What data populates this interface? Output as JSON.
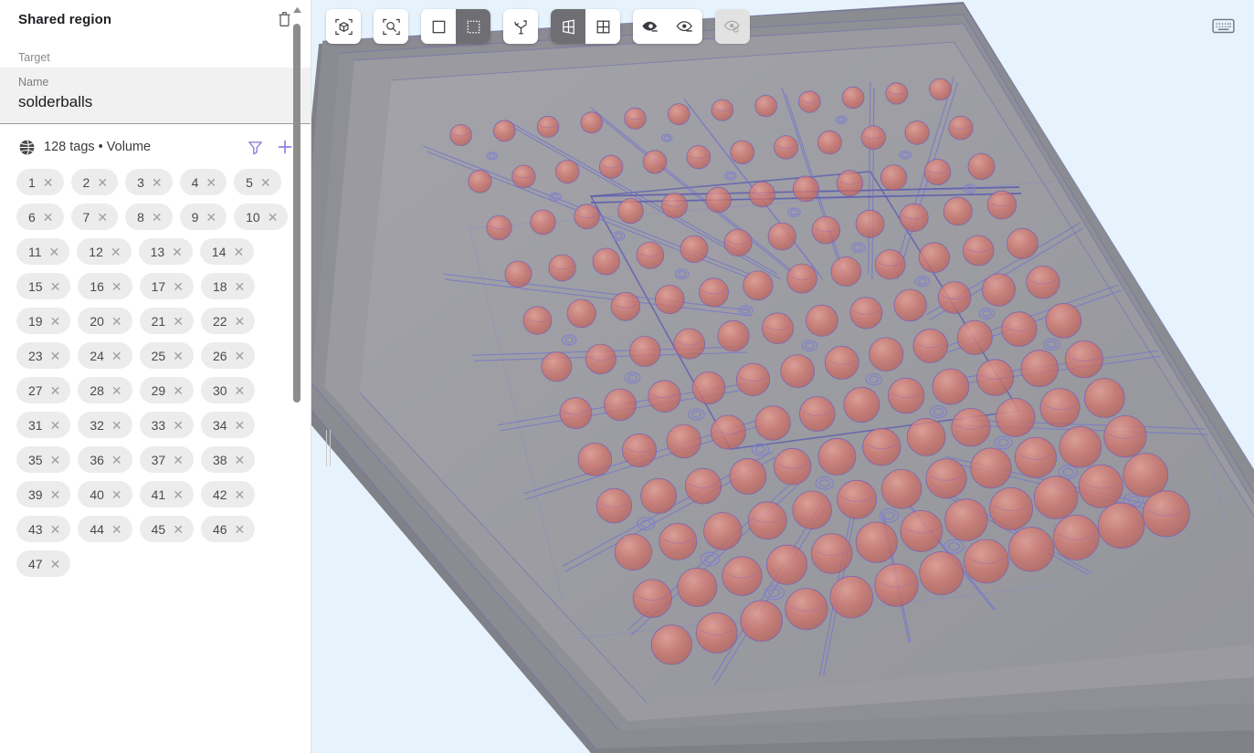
{
  "panel": {
    "title": "Shared region",
    "delete_icon": "trash-icon",
    "section_label": "Target",
    "name_field": {
      "label": "Name",
      "value": "solderballs"
    },
    "tags_summary": {
      "globe_icon": "globe-icon",
      "text": "128 tags • Volume",
      "filter_icon": "filter-icon",
      "add_icon": "plus-icon"
    },
    "chip_close_glyph": "✕",
    "chips": [
      "1",
      "2",
      "3",
      "4",
      "5",
      "6",
      "7",
      "8",
      "9",
      "10",
      "11",
      "12",
      "13",
      "14",
      "15",
      "16",
      "17",
      "18",
      "19",
      "20",
      "21",
      "22",
      "23",
      "24",
      "25",
      "26",
      "27",
      "28",
      "29",
      "30",
      "31",
      "32",
      "33",
      "34",
      "35",
      "36",
      "37",
      "38",
      "39",
      "40",
      "41",
      "42",
      "43",
      "44",
      "45",
      "46",
      "47"
    ],
    "scrollbar": {
      "up_arrow": "▲"
    }
  },
  "toolbar": {
    "groups": [
      {
        "buttons": [
          {
            "name": "fit-to-view-button",
            "icon": "cube-frame-icon",
            "active": false,
            "disabled": false
          }
        ]
      },
      {
        "buttons": [
          {
            "name": "zoom-to-selection-button",
            "icon": "magnifier-frame-icon",
            "active": false,
            "disabled": false
          }
        ]
      },
      {
        "buttons": [
          {
            "name": "rectangle-select-button",
            "icon": "square-icon",
            "active": false,
            "disabled": false
          },
          {
            "name": "marquee-select-button",
            "icon": "dashed-square-icon",
            "active": true,
            "disabled": false
          }
        ]
      },
      {
        "buttons": [
          {
            "name": "axis-gizmo-button",
            "icon": "axes-icon",
            "active": false,
            "disabled": false
          }
        ]
      },
      {
        "buttons": [
          {
            "name": "perspective-view-button",
            "icon": "perspective-grid-icon",
            "active": true,
            "disabled": false
          },
          {
            "name": "orthographic-view-button",
            "icon": "grid-four-icon",
            "active": false,
            "disabled": false
          }
        ]
      },
      {
        "buttons": [
          {
            "name": "hide-selected-button",
            "icon": "eye-minus-icon",
            "active": false,
            "disabled": false
          },
          {
            "name": "isolate-selected-button",
            "icon": "eye-dash-icon",
            "active": false,
            "disabled": false
          }
        ]
      },
      {
        "buttons": [
          {
            "name": "reset-visibility-button",
            "icon": "eye-reset-icon",
            "active": false,
            "disabled": true
          }
        ]
      }
    ]
  },
  "viewport": {
    "keyboard_shortcuts_icon": "keyboard-icon",
    "background_color": "#e6f3fc",
    "model": {
      "name": "solderball-substrate",
      "board_top_color": "#9a9aa0",
      "board_edge_color": "#8b8b92",
      "board_side_color": "#7d7d85",
      "solderball_color": "#d4756c",
      "wire_color": "#6f6fc0"
    }
  }
}
